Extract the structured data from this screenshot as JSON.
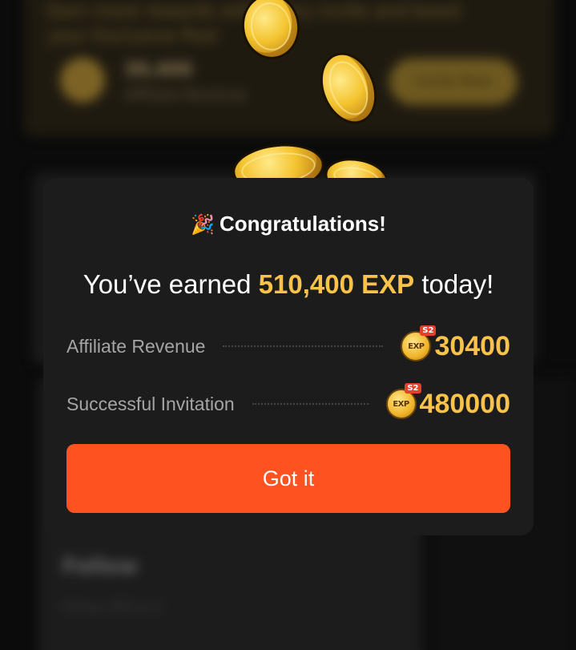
{
  "background": {
    "promo_text": "Earn more rewards with every invite and boost your Exclusive Pool",
    "stat_value": "30,400",
    "stat_label": "Affiliate Revenue",
    "cta_label": "Invite Now",
    "follow_title": "Follow",
    "follow_sub": "Follow official X"
  },
  "modal": {
    "title": "Congratulations!",
    "title_icon": "🎉",
    "headline_prefix": "You’ve earned ",
    "headline_amount": "510,400 EXP",
    "headline_suffix": " today!",
    "rows": [
      {
        "label": "Affiliate Revenue",
        "badge": "EXP",
        "season": "S2",
        "value": "30400"
      },
      {
        "label": "Successful Invitation",
        "badge": "EXP",
        "season": "S2",
        "value": "480000"
      }
    ],
    "button_label": "Got it"
  },
  "colors": {
    "accent": "#f9c34b",
    "button": "#ff5221",
    "modal_bg": "#1c1c1c",
    "page_bg": "#0b0b0b"
  }
}
